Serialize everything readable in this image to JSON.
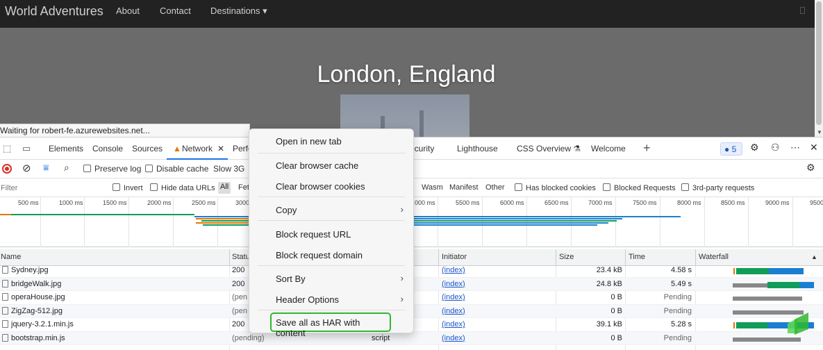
{
  "site": {
    "brand": "World Adventures",
    "nav": [
      "About",
      "Contact",
      "Destinations"
    ],
    "hero_title": "London, England",
    "status_tip": "Waiting for robert-fe.azurewebsites.net..."
  },
  "devtools": {
    "tabs": [
      "Elements",
      "Console",
      "Sources",
      "Network",
      "Perfo",
      "ecurity",
      "Lighthouse",
      "CSS Overview",
      "Welcome"
    ],
    "issues_count": "5",
    "toolbar": {
      "preserve_log": "Preserve log",
      "disable_cache": "Disable cache",
      "throttle": "Slow 3G"
    },
    "filter": {
      "placeholder": "Filter",
      "invert": "Invert",
      "hide_data_urls": "Hide data URLs",
      "all": "All",
      "fet": "Fet",
      "types": [
        "Wasm",
        "Manifest",
        "Other"
      ],
      "has_blocked_cookies": "Has blocked cookies",
      "blocked_requests": "Blocked Requests",
      "third_party": "3rd-party requests"
    },
    "timeline_ticks": [
      "500 ms",
      "1000 ms",
      "1500 ms",
      "2000 ms",
      "2500 ms",
      "3000",
      "000 ms",
      "5500 ms",
      "6000 ms",
      "6500 ms",
      "7000 ms",
      "7500 ms",
      "8000 ms",
      "8500 ms",
      "9000 ms",
      "9500"
    ],
    "columns": [
      "Name",
      "Statu",
      "Initiator",
      "Size",
      "Time",
      "Waterfall"
    ],
    "rows": [
      {
        "name": "Sydney.jpg",
        "status": "200",
        "type": "",
        "initiator": "(index)",
        "size": "23.4 kB",
        "time": "4.58 s"
      },
      {
        "name": "bridgeWalk.jpg",
        "status": "200",
        "type": "",
        "initiator": "(index)",
        "size": "24.8 kB",
        "time": "5.49 s"
      },
      {
        "name": "operaHouse.jpg",
        "status": "(pen",
        "type": "",
        "initiator": "(index)",
        "size": "0 B",
        "time": "Pending"
      },
      {
        "name": "ZigZag-512.jpg",
        "status": "(pen",
        "type": "",
        "initiator": "(index)",
        "size": "0 B",
        "time": "Pending"
      },
      {
        "name": "jquery-3.2.1.min.js",
        "status": "200",
        "type": "",
        "initiator": "(index)",
        "size": "39.1 kB",
        "time": "5.28 s"
      },
      {
        "name": "bootstrap.min.js",
        "status": "(pending)",
        "type": "script",
        "initiator": "(index)",
        "size": "0 B",
        "time": "Pending"
      }
    ]
  },
  "context_menu": {
    "open_new_tab": "Open in new tab",
    "clear_cache": "Clear browser cache",
    "clear_cookies": "Clear browser cookies",
    "copy": "Copy",
    "block_url": "Block request URL",
    "block_domain": "Block request domain",
    "sort_by": "Sort By",
    "header_options": "Header Options",
    "save_har": "Save all as HAR with content"
  },
  "colors": {
    "accent": "#1a73e8",
    "highlight": "#2eb82e",
    "waterfall_green": "#0f9d58",
    "waterfall_blue": "#1a7fd0",
    "record": "#d93025"
  }
}
